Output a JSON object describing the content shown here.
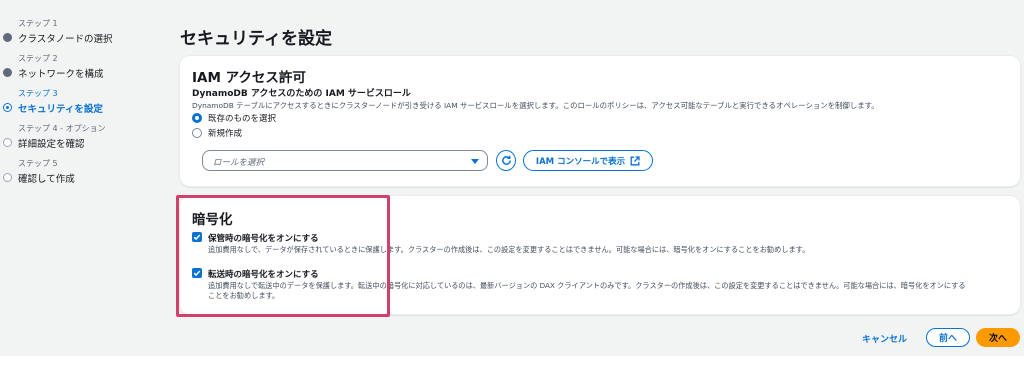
{
  "steps": [
    {
      "sub": "ステップ 1",
      "label": "クラスタノードの選択",
      "state": "done"
    },
    {
      "sub": "ステップ 2",
      "label": "ネットワークを構成",
      "state": "done"
    },
    {
      "sub": "ステップ 3",
      "label": "セキュリティを設定",
      "state": "current"
    },
    {
      "sub": "ステップ 4 - オプション",
      "label": "詳細設定を確認",
      "state": "pending"
    },
    {
      "sub": "ステップ 5",
      "label": "確認して作成",
      "state": "pending"
    }
  ],
  "page_title": "セキュリティを設定",
  "iam": {
    "header": "IAM アクセス許可",
    "field_label": "DynamoDB アクセスのための IAM サービスロール",
    "field_desc": "DynamoDB テーブルにアクセスするときにクラスターノードが引き受ける IAM サービスロールを選択します。このロールのポリシーは、アクセス可能なテーブルと実行できるオペレーションを制御します。",
    "radio_existing": "既存のものを選択",
    "radio_new": "新規作成",
    "selected_radio": "existing",
    "select_placeholder": "ロールを選択",
    "console_button": "IAM コンソールで表示"
  },
  "encryption": {
    "header": "暗号化",
    "at_rest_label": "保管時の暗号化をオンにする",
    "at_rest_desc": "追加費用なしで、データが保存されているときに保護します。クラスターの作成後は、この設定を変更することはできません。可能な場合には、暗号化をオンにすることをお勧めします。",
    "at_rest_checked": true,
    "in_transit_label": "転送時の暗号化をオンにする",
    "in_transit_desc_1": "追加費用なしで転送中のデータを保護します。転送中の暗号化に対応しているのは、最新バージョンの DAX クライアントのみです。クラスターの作成後は、この設定を変更することはできません。可能な場合には、暗号化をオンにする",
    "in_transit_desc_2": "ことをお勧めします。",
    "in_transit_checked": true
  },
  "footer": {
    "cancel": "キャンセル",
    "prev": "前へ",
    "next": "次へ"
  },
  "colors": {
    "accent": "#0972d3",
    "primary_button": "#ff9900",
    "highlight": "#d1416c"
  }
}
